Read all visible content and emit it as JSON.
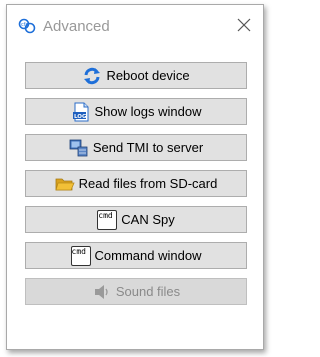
{
  "window": {
    "title": "Advanced",
    "icon": "app-chain-icon",
    "close_icon": "close-icon"
  },
  "buttons": [
    {
      "label": "Reboot device",
      "icon": "reboot-icon",
      "enabled": true
    },
    {
      "label": "Show logs window",
      "icon": "log-file-icon",
      "enabled": true
    },
    {
      "label": "Send TMI to server",
      "icon": "send-server-icon",
      "enabled": true
    },
    {
      "label": "Read files from SD-card",
      "icon": "folder-icon",
      "enabled": true
    },
    {
      "label": "CAN Spy",
      "icon": "cmd-icon",
      "icon_text": "cmd",
      "enabled": true
    },
    {
      "label": "Command window",
      "icon": "cmd-icon",
      "icon_text": "cmd",
      "enabled": true
    },
    {
      "label": "Sound files",
      "icon": "speaker-icon",
      "enabled": false
    }
  ],
  "colors": {
    "accent_blue": "#1e6fd9",
    "folder_yellow": "#f2c037",
    "disabled_text": "#8a8a8a"
  }
}
